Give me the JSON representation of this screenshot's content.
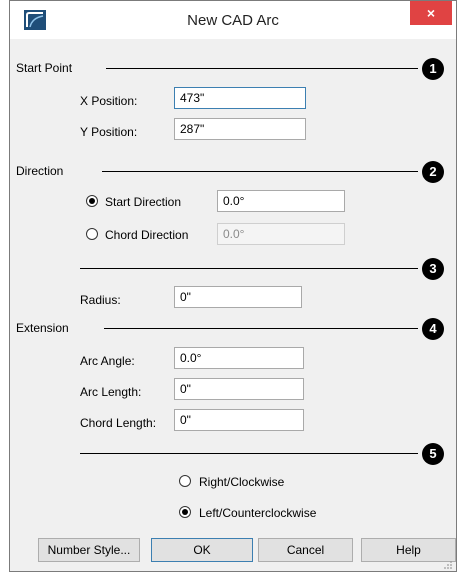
{
  "window": {
    "title": "New CAD Arc",
    "close_glyph": "×"
  },
  "sections": {
    "start_point": {
      "label": "Start Point",
      "marker": "1",
      "x_label": "X Position:",
      "x_value": "473\"",
      "y_label": "Y Position:",
      "y_value": "287\""
    },
    "direction": {
      "label": "Direction",
      "marker": "2",
      "start_label": "Start Direction",
      "start_value": "0.0°",
      "start_checked": true,
      "chord_label": "Chord Direction",
      "chord_value": "0.0°",
      "chord_checked": false
    },
    "radius": {
      "marker": "3",
      "label": "Radius:",
      "value": "0\""
    },
    "extension": {
      "label": "Extension",
      "marker": "4",
      "arc_angle_label": "Arc Angle:",
      "arc_angle_value": "0.0°",
      "arc_length_label": "Arc Length:",
      "arc_length_value": "0\"",
      "chord_length_label": "Chord Length:",
      "chord_length_value": "0\""
    },
    "orientation": {
      "marker": "5",
      "right_label": "Right/Clockwise",
      "right_checked": false,
      "left_label": "Left/Counterclockwise",
      "left_checked": true
    }
  },
  "buttons": {
    "number_style": "Number Style...",
    "ok": "OK",
    "cancel": "Cancel",
    "help": "Help"
  },
  "colors": {
    "close": "#e04343",
    "focus_border": "#3c7fb1",
    "icon": "#1f4e79"
  }
}
